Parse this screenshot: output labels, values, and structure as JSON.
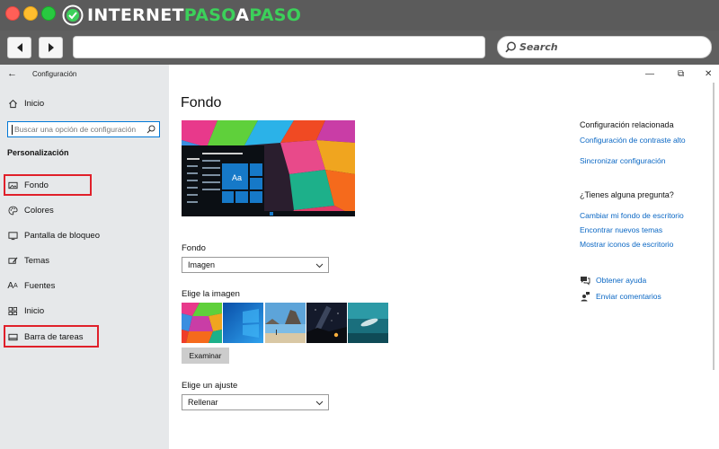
{
  "brand": {
    "part1": "INTERNET",
    "part2": "PASO",
    "part3": "A",
    "part4": "PASO",
    "accent_color": "#3cd05a"
  },
  "browser": {
    "back_icon": "arrow-left-icon",
    "forward_icon": "arrow-right-icon",
    "address_value": "",
    "search_placeholder": "Search"
  },
  "settings": {
    "app_title": "Configuración",
    "sidebar": {
      "home_label": "Inicio",
      "search_placeholder": "Buscar una opción de configuración",
      "section_title": "Personalización",
      "items": [
        {
          "label": "Fondo",
          "icon": "picture-icon"
        },
        {
          "label": "Colores",
          "icon": "palette-icon"
        },
        {
          "label": "Pantalla de bloqueo",
          "icon": "lock-screen-icon"
        },
        {
          "label": "Temas",
          "icon": "themes-icon"
        },
        {
          "label": "Fuentes",
          "icon": "fonts-icon"
        },
        {
          "label": "Inicio",
          "icon": "start-icon"
        },
        {
          "label": "Barra de tareas",
          "icon": "taskbar-icon"
        }
      ]
    },
    "main": {
      "title": "Fondo",
      "preview_tile_text": "Aa",
      "fondo_label": "Fondo",
      "fondo_value": "Imagen",
      "choose_image_label": "Elige la imagen",
      "browse_button": "Examinar",
      "fit_label": "Elige un ajuste",
      "fit_value": "Rellenar"
    },
    "related": {
      "heading": "Configuración relacionada",
      "links": [
        "Configuración de contraste alto",
        "Sincronizar configuración"
      ],
      "question_heading": "¿Tienes alguna pregunta?",
      "question_links": [
        "Cambiar mi fondo de escritorio",
        "Encontrar nuevos temas",
        "Mostrar iconos de escritorio"
      ],
      "help_label": "Obtener ayuda",
      "feedback_label": "Enviar comentarios"
    },
    "colors": {
      "link": "#0a67c4",
      "highlight": "#e0202a",
      "accent": "#0078d7"
    }
  }
}
